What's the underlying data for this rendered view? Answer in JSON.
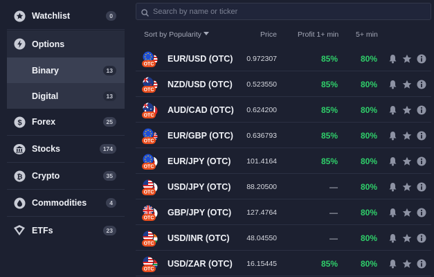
{
  "sidebar": {
    "items": [
      {
        "label": "Watchlist",
        "count": "0",
        "icon": "star-circle-icon"
      },
      {
        "label": "Options",
        "icon": "lightning-icon"
      },
      {
        "label": "Forex",
        "count": "25",
        "icon": "dollar-coin-icon"
      },
      {
        "label": "Stocks",
        "count": "174",
        "icon": "bank-icon"
      },
      {
        "label": "Crypto",
        "count": "35",
        "icon": "bitcoin-icon"
      },
      {
        "label": "Commodities",
        "count": "4",
        "icon": "drop-icon"
      },
      {
        "label": "ETFs",
        "count": "23",
        "icon": "etf-icon"
      }
    ],
    "options_sub": [
      {
        "label": "Binary",
        "count": "13"
      },
      {
        "label": "Digital",
        "count": "13"
      }
    ]
  },
  "search": {
    "placeholder": "Search by name or ticker"
  },
  "table": {
    "headers": {
      "sort": "Sort by Popularity",
      "price": "Price",
      "profit1": "Profit 1+ min",
      "profit5": "5+ min"
    },
    "badge": "OTC",
    "rows": [
      {
        "name": "EUR/USD (OTC)",
        "price": "0.972307",
        "p1": "85%",
        "p5": "80%",
        "flags": [
          "eu",
          "us"
        ]
      },
      {
        "name": "NZD/USD (OTC)",
        "price": "0.523550",
        "p1": "85%",
        "p5": "80%",
        "flags": [
          "nz",
          "us"
        ]
      },
      {
        "name": "AUD/CAD (OTC)",
        "price": "0.624200",
        "p1": "85%",
        "p5": "80%",
        "flags": [
          "au",
          "ca"
        ]
      },
      {
        "name": "EUR/GBP (OTC)",
        "price": "0.636793",
        "p1": "85%",
        "p5": "80%",
        "flags": [
          "eu",
          "gb"
        ]
      },
      {
        "name": "EUR/JPY (OTC)",
        "price": "101.4164",
        "p1": "85%",
        "p5": "80%",
        "flags": [
          "eu",
          "jp"
        ]
      },
      {
        "name": "USD/JPY (OTC)",
        "price": "88.20500",
        "p1": "—",
        "p5": "80%",
        "flags": [
          "us",
          "jp"
        ]
      },
      {
        "name": "GBP/JPY (OTC)",
        "price": "127.4764",
        "p1": "—",
        "p5": "80%",
        "flags": [
          "gb",
          "jp"
        ]
      },
      {
        "name": "USD/INR (OTC)",
        "price": "48.04550",
        "p1": "—",
        "p5": "80%",
        "flags": [
          "us",
          "in"
        ]
      },
      {
        "name": "USD/ZAR (OTC)",
        "price": "16.15445",
        "p1": "85%",
        "p5": "80%",
        "flags": [
          "us",
          "za"
        ]
      }
    ]
  },
  "colors": {
    "accent_green": "#2fcf6a",
    "bg": "#1c2030",
    "otc_badge": "#e84c1c"
  }
}
